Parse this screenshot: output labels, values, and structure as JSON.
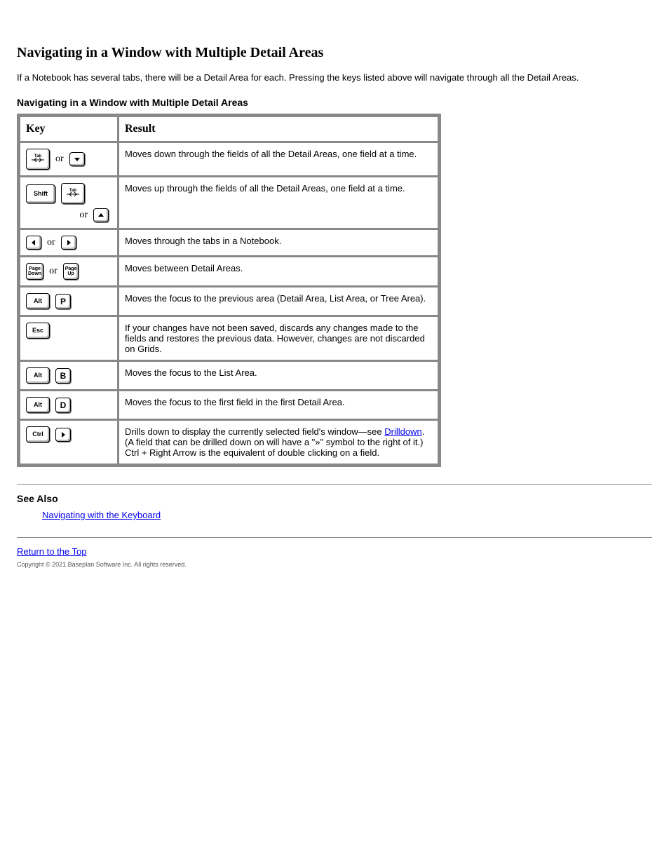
{
  "section_heading": "Navigating in a Window with Multiple Detail Areas",
  "notebook_text": "If a Notebook has several tabs, there will be a Detail Area for each. Pressing the keys listed above will navigate through all the Detail Areas.",
  "table": {
    "headers": {
      "key": "Key",
      "result": "Result"
    },
    "rows": [
      {
        "id": "tab-down",
        "keys": [
          [
            "tab"
          ],
          [
            "down"
          ]
        ],
        "or_between": true,
        "result": "Moves down through the fields of all the Detail Areas, one field at a time."
      },
      {
        "id": "shift-tab-up",
        "keys": [
          [
            "shift",
            "tab"
          ],
          [
            "up"
          ]
        ],
        "or_between": true,
        "multi_line": true,
        "result": "Moves up through the fields of all the Detail Areas, one field at a time."
      },
      {
        "id": "left-right",
        "keys": [
          [
            "left"
          ],
          [
            "right"
          ]
        ],
        "or_between": true,
        "result": "Moves through the tabs in a Notebook."
      },
      {
        "id": "pgdn-pgup",
        "keys": [
          [
            "pagedown"
          ],
          [
            "pageup"
          ]
        ],
        "or_between": true,
        "result": "Moves between Detail Areas."
      },
      {
        "id": "alt-p",
        "keys": [
          [
            "alt",
            "P"
          ]
        ],
        "result": "Moves the focus to the previous area (Detail Area, List Area, or Tree Area)."
      },
      {
        "id": "esc",
        "keys": [
          [
            "esc"
          ]
        ],
        "result": "If your changes have not been saved, discards any changes made to the fields and restores the previous data. However, changes are not discarded on Grids."
      },
      {
        "id": "alt-b",
        "keys": [
          [
            "alt",
            "B"
          ]
        ],
        "result": "Moves the focus to the List Area."
      },
      {
        "id": "alt-d",
        "keys": [
          [
            "alt",
            "D"
          ]
        ],
        "result": "Moves the focus to the first field in the first Detail Area."
      },
      {
        "id": "ctrl-right",
        "keys": [
          [
            "ctrl",
            "right"
          ]
        ],
        "result_pre": "Drills down to display the currently selected field's window—see ",
        "link_text": "Drilldown",
        "result_post": ". (A field that can be drilled down on will have a \"»\" symbol to the right of it.) Ctrl + Right Arrow is the equivalent of double clicking on a field."
      }
    ]
  },
  "see_also": {
    "label": "See Also",
    "link": "Navigating with the Keyboard"
  },
  "back_to_top": "Return to the Top",
  "copyright": "Copyright © 2021 Baseplan Software Inc. All rights reserved."
}
